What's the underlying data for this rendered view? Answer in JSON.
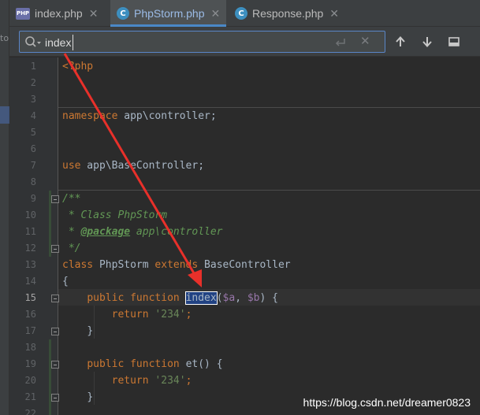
{
  "side_panel": {
    "clipped_label": "to"
  },
  "tabs": [
    {
      "label": "index.php",
      "icon": "php-file-icon",
      "active": false
    },
    {
      "label": "PhpStorm.php",
      "icon": "class-c-icon",
      "active": true
    },
    {
      "label": "Response.php",
      "icon": "class-c-icon",
      "active": false
    }
  ],
  "search": {
    "query": "index",
    "match_case_icon": "enter-arrow-icon"
  },
  "code_lines": [
    {
      "n": "1",
      "text": "<?php"
    },
    {
      "n": "2",
      "text": ""
    },
    {
      "n": "3",
      "text": ""
    },
    {
      "n": "4",
      "text": "namespace app\\controller;"
    },
    {
      "n": "5",
      "text": ""
    },
    {
      "n": "6",
      "text": ""
    },
    {
      "n": "7",
      "text": "use app\\BaseController;"
    },
    {
      "n": "8",
      "text": ""
    },
    {
      "n": "9",
      "text": "/**"
    },
    {
      "n": "10",
      "text": " * Class PhpStorm"
    },
    {
      "n": "11",
      "text": " * @package app\\controller"
    },
    {
      "n": "12",
      "text": " */"
    },
    {
      "n": "13",
      "text": "class PhpStorm extends BaseController"
    },
    {
      "n": "14",
      "text": "{"
    },
    {
      "n": "15",
      "text": "    public function index($a, $b) {"
    },
    {
      "n": "16",
      "text": "        return '234';"
    },
    {
      "n": "17",
      "text": "    }"
    },
    {
      "n": "18",
      "text": ""
    },
    {
      "n": "19",
      "text": "    public function et() {"
    },
    {
      "n": "20",
      "text": "        return '234';"
    },
    {
      "n": "21",
      "text": "    }"
    },
    {
      "n": "22",
      "text": ""
    }
  ],
  "current_line": "15",
  "tokens": {
    "php_open_lt": "<",
    "php_open_rest": "?php",
    "namespace_kw": "namespace",
    "namespace_val": " app\\controller;",
    "use_kw": "use",
    "use_val": " app\\BaseController;",
    "doc_open": "/**",
    "doc_class_line": " * Class PhpStorm",
    "doc_star": " * ",
    "doc_package_tag": "@package",
    "doc_package_val": " app\\controller",
    "doc_close": " */",
    "class_kw": "class",
    "class_name": " PhpStorm ",
    "extends_kw": "extends",
    "parent_class": " BaseController",
    "brace_open": "{",
    "indent4": "    ",
    "indent8": "        ",
    "public_kw": "public",
    "function_kw": " function ",
    "method_index": "index",
    "args_open": "(",
    "arg_a": "$a",
    "args_comma": ", ",
    "arg_b": "$b",
    "args_close": ") {",
    "return_kw": "return",
    "return_val": " '234'",
    "semicolon": ";",
    "brace_close": "}",
    "method_et": "et",
    "et_args": "() {"
  },
  "watermark": "https://blog.csdn.net/dreamer0823",
  "colors": {
    "arrow": "#e8302a",
    "keyword": "#cc7832",
    "string": "#6a8759",
    "doc": "#629755",
    "variable": "#9876aa",
    "search_hit_bg": "#214283",
    "tab_underline": "#4a88c7"
  }
}
